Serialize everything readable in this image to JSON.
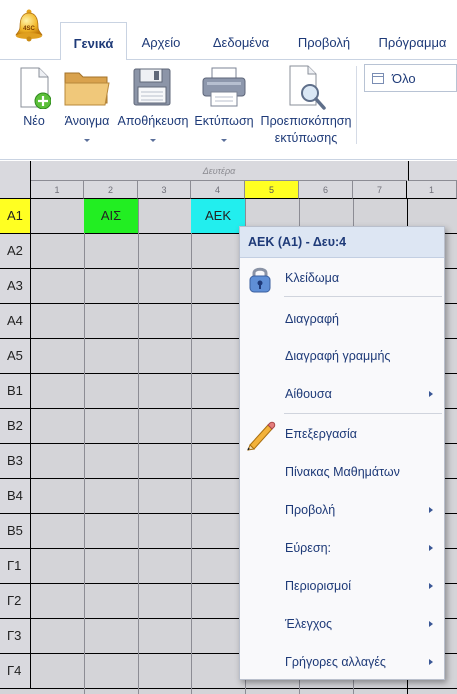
{
  "app_orb_text": "4SC",
  "tabs": [
    {
      "label": "Γενικά",
      "active": true
    },
    {
      "label": "Αρχείο"
    },
    {
      "label": "Δεδομένα"
    },
    {
      "label": "Προβολή"
    },
    {
      "label": "Πρόγραμμα"
    }
  ],
  "ribbon": {
    "buttons": [
      {
        "label": "Νέο",
        "icon": "new-document-icon"
      },
      {
        "label": "Άνοιγμα",
        "icon": "folder-icon"
      },
      {
        "label": "Αποθήκευση",
        "icon": "floppy-disk-icon"
      },
      {
        "label": "Εκτύπωση",
        "icon": "printer-icon"
      },
      {
        "label": "Προεπισκόπηση εκτύπωσης",
        "icon": "print-preview-icon"
      }
    ],
    "filter_value": "Όλο"
  },
  "timetable": {
    "day_label": "Δευτέρα",
    "periods": [
      "1",
      "2",
      "3",
      "4",
      "5",
      "6",
      "7",
      "1"
    ],
    "highlighted_period": "5",
    "rows": [
      "A1",
      "A2",
      "A3",
      "A4",
      "A5",
      "B1",
      "B2",
      "B3",
      "B4",
      "B5",
      "Γ1",
      "Γ2",
      "Γ3",
      "Γ4"
    ],
    "highlighted_row": "A1",
    "lessons": [
      {
        "row": "A1",
        "period": "2",
        "text": "ΑΙΣ",
        "color": "#22ee22"
      },
      {
        "row": "A1",
        "period": "4",
        "text": "ΑΕΚ",
        "color": "#22eeee"
      }
    ]
  },
  "context_menu": {
    "header": "ΑΕΚ (A1) - Δευ:4",
    "items": [
      {
        "label": "Κλείδωμα",
        "icon": "padlock-icon"
      },
      {
        "label": "Διαγραφή"
      },
      {
        "label": "Διαγραφή γραμμής"
      },
      {
        "label": "Αίθουσα",
        "submenu": true
      },
      {
        "label": "Επεξεργασία",
        "icon": "pencil-icon"
      },
      {
        "label": "Πίνακας Μαθημάτων"
      },
      {
        "label": "Προβολή",
        "submenu": true
      },
      {
        "label": "Εύρεση:",
        "submenu": true
      },
      {
        "label": "Περιορισμοί",
        "submenu": true
      },
      {
        "label": "Έλεγχος",
        "submenu": true
      },
      {
        "label": "Γρήγορες αλλαγές",
        "submenu": true
      }
    ]
  }
}
